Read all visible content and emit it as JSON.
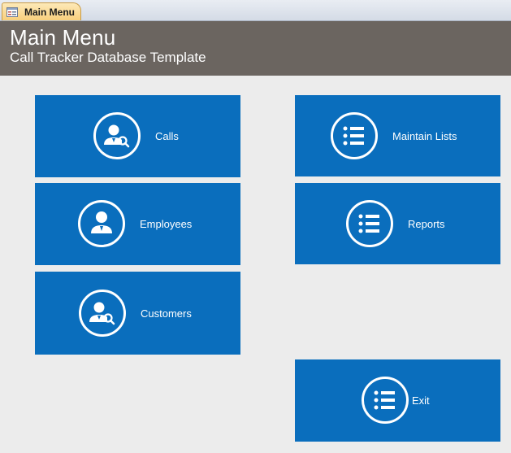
{
  "window": {
    "tab_label": "Main Menu",
    "tab_icon": "form-icon"
  },
  "header": {
    "title": "Main Menu",
    "subtitle": "Call Tracker Database Template",
    "background": "#6b6560"
  },
  "theme": {
    "tile_color": "#0a6ebd",
    "background": "#ececec"
  },
  "tiles": {
    "calls": {
      "label": "Calls",
      "icon": "person-search-icon"
    },
    "employees": {
      "label": "Employees",
      "icon": "person-icon"
    },
    "customers": {
      "label": "Customers",
      "icon": "person-search-icon"
    },
    "maintain_lists": {
      "label": "Maintain Lists",
      "icon": "list-icon"
    },
    "reports": {
      "label": "Reports",
      "icon": "list-icon"
    },
    "exit": {
      "label": "Exit",
      "icon": "list-icon"
    }
  }
}
